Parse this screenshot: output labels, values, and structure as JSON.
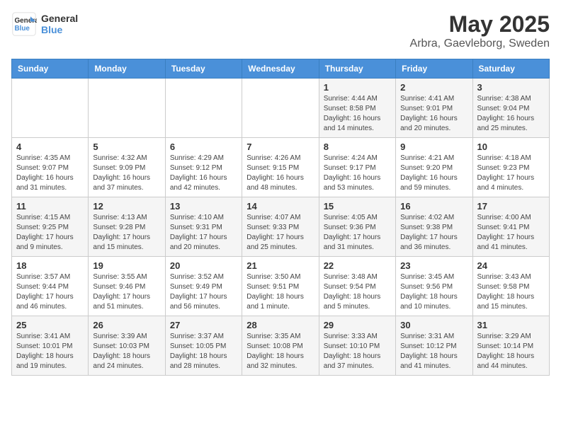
{
  "header": {
    "logo_line1": "General",
    "logo_line2": "Blue",
    "title": "May 2025",
    "subtitle": "Arbra, Gaevleborg, Sweden"
  },
  "weekdays": [
    "Sunday",
    "Monday",
    "Tuesday",
    "Wednesday",
    "Thursday",
    "Friday",
    "Saturday"
  ],
  "weeks": [
    [
      {
        "num": "",
        "detail": ""
      },
      {
        "num": "",
        "detail": ""
      },
      {
        "num": "",
        "detail": ""
      },
      {
        "num": "",
        "detail": ""
      },
      {
        "num": "1",
        "detail": "Sunrise: 4:44 AM\nSunset: 8:58 PM\nDaylight: 16 hours\nand 14 minutes."
      },
      {
        "num": "2",
        "detail": "Sunrise: 4:41 AM\nSunset: 9:01 PM\nDaylight: 16 hours\nand 20 minutes."
      },
      {
        "num": "3",
        "detail": "Sunrise: 4:38 AM\nSunset: 9:04 PM\nDaylight: 16 hours\nand 25 minutes."
      }
    ],
    [
      {
        "num": "4",
        "detail": "Sunrise: 4:35 AM\nSunset: 9:07 PM\nDaylight: 16 hours\nand 31 minutes."
      },
      {
        "num": "5",
        "detail": "Sunrise: 4:32 AM\nSunset: 9:09 PM\nDaylight: 16 hours\nand 37 minutes."
      },
      {
        "num": "6",
        "detail": "Sunrise: 4:29 AM\nSunset: 9:12 PM\nDaylight: 16 hours\nand 42 minutes."
      },
      {
        "num": "7",
        "detail": "Sunrise: 4:26 AM\nSunset: 9:15 PM\nDaylight: 16 hours\nand 48 minutes."
      },
      {
        "num": "8",
        "detail": "Sunrise: 4:24 AM\nSunset: 9:17 PM\nDaylight: 16 hours\nand 53 minutes."
      },
      {
        "num": "9",
        "detail": "Sunrise: 4:21 AM\nSunset: 9:20 PM\nDaylight: 16 hours\nand 59 minutes."
      },
      {
        "num": "10",
        "detail": "Sunrise: 4:18 AM\nSunset: 9:23 PM\nDaylight: 17 hours\nand 4 minutes."
      }
    ],
    [
      {
        "num": "11",
        "detail": "Sunrise: 4:15 AM\nSunset: 9:25 PM\nDaylight: 17 hours\nand 9 minutes."
      },
      {
        "num": "12",
        "detail": "Sunrise: 4:13 AM\nSunset: 9:28 PM\nDaylight: 17 hours\nand 15 minutes."
      },
      {
        "num": "13",
        "detail": "Sunrise: 4:10 AM\nSunset: 9:31 PM\nDaylight: 17 hours\nand 20 minutes."
      },
      {
        "num": "14",
        "detail": "Sunrise: 4:07 AM\nSunset: 9:33 PM\nDaylight: 17 hours\nand 25 minutes."
      },
      {
        "num": "15",
        "detail": "Sunrise: 4:05 AM\nSunset: 9:36 PM\nDaylight: 17 hours\nand 31 minutes."
      },
      {
        "num": "16",
        "detail": "Sunrise: 4:02 AM\nSunset: 9:38 PM\nDaylight: 17 hours\nand 36 minutes."
      },
      {
        "num": "17",
        "detail": "Sunrise: 4:00 AM\nSunset: 9:41 PM\nDaylight: 17 hours\nand 41 minutes."
      }
    ],
    [
      {
        "num": "18",
        "detail": "Sunrise: 3:57 AM\nSunset: 9:44 PM\nDaylight: 17 hours\nand 46 minutes."
      },
      {
        "num": "19",
        "detail": "Sunrise: 3:55 AM\nSunset: 9:46 PM\nDaylight: 17 hours\nand 51 minutes."
      },
      {
        "num": "20",
        "detail": "Sunrise: 3:52 AM\nSunset: 9:49 PM\nDaylight: 17 hours\nand 56 minutes."
      },
      {
        "num": "21",
        "detail": "Sunrise: 3:50 AM\nSunset: 9:51 PM\nDaylight: 18 hours\nand 1 minute."
      },
      {
        "num": "22",
        "detail": "Sunrise: 3:48 AM\nSunset: 9:54 PM\nDaylight: 18 hours\nand 5 minutes."
      },
      {
        "num": "23",
        "detail": "Sunrise: 3:45 AM\nSunset: 9:56 PM\nDaylight: 18 hours\nand 10 minutes."
      },
      {
        "num": "24",
        "detail": "Sunrise: 3:43 AM\nSunset: 9:58 PM\nDaylight: 18 hours\nand 15 minutes."
      }
    ],
    [
      {
        "num": "25",
        "detail": "Sunrise: 3:41 AM\nSunset: 10:01 PM\nDaylight: 18 hours\nand 19 minutes."
      },
      {
        "num": "26",
        "detail": "Sunrise: 3:39 AM\nSunset: 10:03 PM\nDaylight: 18 hours\nand 24 minutes."
      },
      {
        "num": "27",
        "detail": "Sunrise: 3:37 AM\nSunset: 10:05 PM\nDaylight: 18 hours\nand 28 minutes."
      },
      {
        "num": "28",
        "detail": "Sunrise: 3:35 AM\nSunset: 10:08 PM\nDaylight: 18 hours\nand 32 minutes."
      },
      {
        "num": "29",
        "detail": "Sunrise: 3:33 AM\nSunset: 10:10 PM\nDaylight: 18 hours\nand 37 minutes."
      },
      {
        "num": "30",
        "detail": "Sunrise: 3:31 AM\nSunset: 10:12 PM\nDaylight: 18 hours\nand 41 minutes."
      },
      {
        "num": "31",
        "detail": "Sunrise: 3:29 AM\nSunset: 10:14 PM\nDaylight: 18 hours\nand 44 minutes."
      }
    ]
  ]
}
